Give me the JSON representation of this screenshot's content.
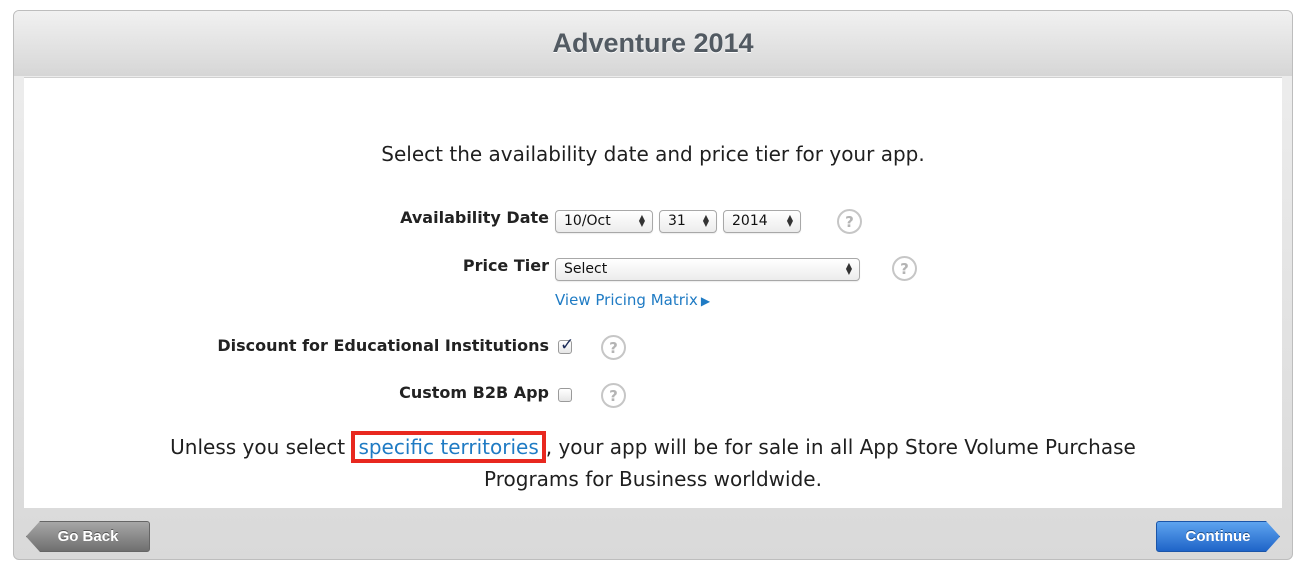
{
  "header": {
    "title": "Adventure 2014"
  },
  "intro": "Select the availability date and price tier for your app.",
  "availability": {
    "label": "Availability Date",
    "month": "10/Oct",
    "day": "31",
    "year": "2014"
  },
  "price_tier": {
    "label": "Price Tier",
    "value": "Select",
    "matrix_link": "View Pricing Matrix"
  },
  "discount_edu": {
    "label": "Discount for Educational Institutions",
    "checked": true
  },
  "custom_b2b": {
    "label": "Custom B2B App",
    "checked": false
  },
  "help": {
    "glyph": "?"
  },
  "footer": {
    "before": "Unless you select ",
    "link": "specific territories",
    "after": ", your app will be for sale in all App Store Volume Purchase",
    "line2": "Programs for Business worldwide."
  },
  "buttons": {
    "back": "Go Back",
    "continue": "Continue"
  },
  "colors": {
    "link": "#1f7bc4",
    "highlight": "#e8281f",
    "continue": "#2e75d6"
  }
}
